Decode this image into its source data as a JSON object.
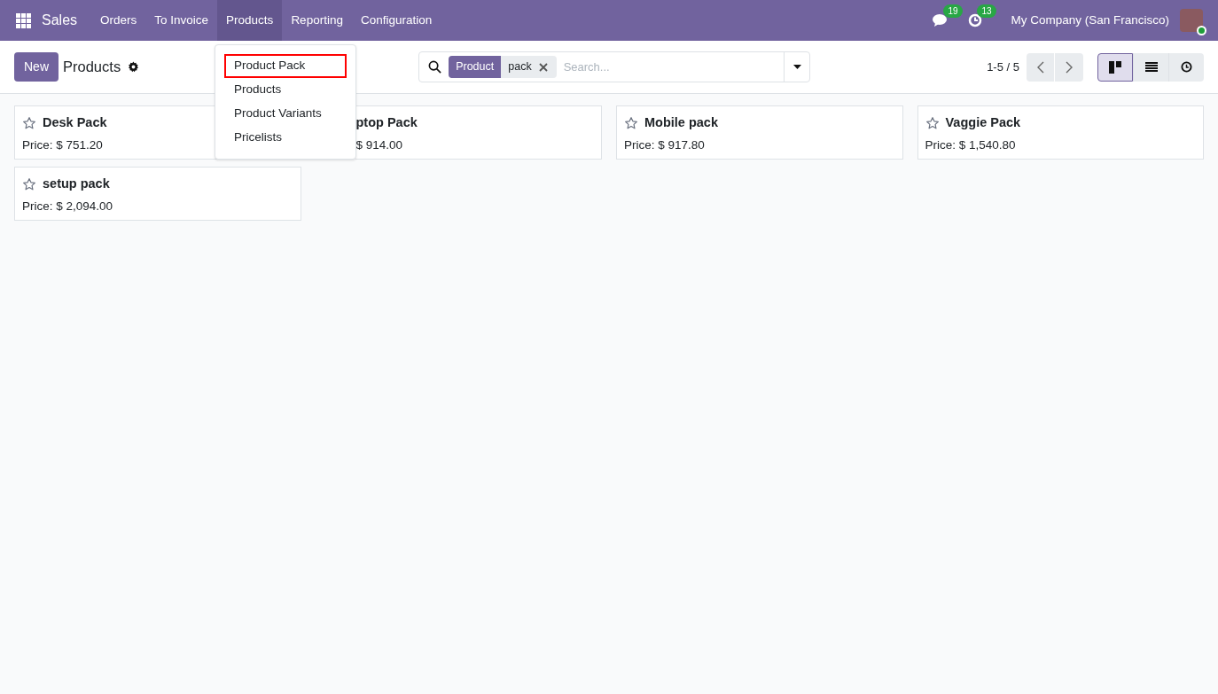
{
  "navbar": {
    "app": "Sales",
    "menu": [
      {
        "label": "Orders",
        "selected": false
      },
      {
        "label": "To Invoice",
        "selected": false
      },
      {
        "label": "Products",
        "selected": true
      },
      {
        "label": "Reporting",
        "selected": false
      },
      {
        "label": "Configuration",
        "selected": false
      }
    ],
    "messages_count": "19",
    "activities_count": "13",
    "company": "My Company (San Francisco)"
  },
  "dropdown": {
    "items": [
      {
        "label": "Product Pack",
        "highlighted": true
      },
      {
        "label": "Products",
        "highlighted": false
      },
      {
        "label": "Product Variants",
        "highlighted": false
      },
      {
        "label": "Pricelists",
        "highlighted": false
      }
    ]
  },
  "control_panel": {
    "new_button": "New",
    "title": "Products",
    "search": {
      "facet_label": "Product",
      "facet_value": "pack",
      "placeholder": "Search..."
    },
    "pager": "1-5 / 5",
    "views": [
      {
        "kind": "kanban",
        "selected": true
      },
      {
        "kind": "list",
        "selected": false
      },
      {
        "kind": "activity",
        "selected": false
      }
    ]
  },
  "cards": [
    {
      "title": "Desk Pack",
      "price": "Price: $ 751.20",
      "covered": false
    },
    {
      "title": "ptop Pack",
      "price": "$ 914.00",
      "covered": true
    },
    {
      "title": "Mobile pack",
      "price": "Price: $ 917.80",
      "covered": false
    },
    {
      "title": "Vaggie Pack",
      "price": "Price: $ 1,540.80",
      "covered": false
    },
    {
      "title": "setup pack",
      "price": "Price: $ 2,094.00",
      "covered": false
    }
  ]
}
